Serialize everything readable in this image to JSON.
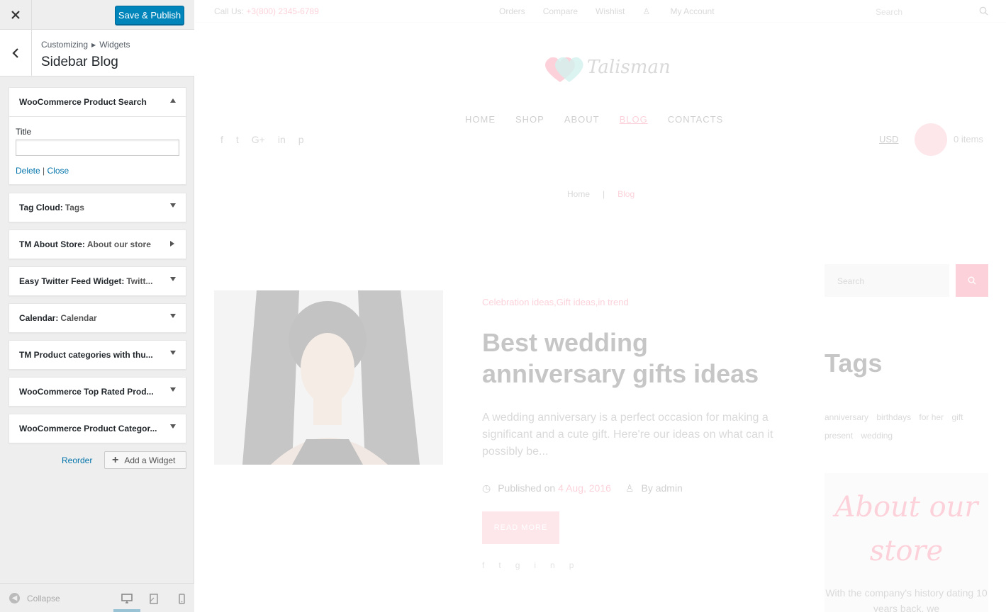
{
  "customizer": {
    "save_label": "Save & Publish",
    "breadcrumb": [
      "Customizing",
      "Widgets"
    ],
    "section_title": "Sidebar Blog",
    "widgets": [
      {
        "name": "WooCommerce Product Search",
        "subtitle": "",
        "state": "expanded"
      },
      {
        "name": "Tag Cloud:",
        "subtitle": "Tags",
        "state": "collapsed"
      },
      {
        "name": "TM About Store:",
        "subtitle": "About our store",
        "state": "collapsed-right"
      },
      {
        "name": "Easy Twitter Feed Widget:",
        "subtitle": "Twitt...",
        "state": "collapsed"
      },
      {
        "name": "Calendar:",
        "subtitle": "Calendar",
        "state": "collapsed"
      },
      {
        "name": "TM Product categories with thu...",
        "subtitle": "",
        "state": "collapsed"
      },
      {
        "name": "WooCommerce Top Rated Prod...",
        "subtitle": "",
        "state": "collapsed"
      },
      {
        "name": "WooCommerce Product Categor...",
        "subtitle": "",
        "state": "collapsed"
      }
    ],
    "expanded_widget": {
      "title_label": "Title",
      "title_value": "",
      "delete_label": "Delete",
      "separator": "|",
      "close_label": "Close"
    },
    "reorder_label": "Reorder",
    "add_widget_label": "Add a Widget",
    "collapse_label": "Collapse",
    "devices": [
      "desktop",
      "tablet",
      "mobile"
    ],
    "active_device": "desktop"
  },
  "preview": {
    "call_label": "Call Us:",
    "phone": "+3(800) 2345-6789",
    "top_links": [
      "Orders",
      "Compare",
      "Wishlist",
      "My Account"
    ],
    "search_placeholder": "Search",
    "logo_text": "Talisman",
    "nav": [
      "HOME",
      "SHOP",
      "ABOUT",
      "BLOG",
      "CONTACTS"
    ],
    "active_nav": "BLOG",
    "currency": "USD",
    "cart_text": "0 items",
    "breadcrumb": [
      "Home",
      "|",
      "Blog"
    ],
    "post": {
      "categories": "Celebration ideas,Gift ideas,in trend",
      "title": "Best wedding anniversary gifts ideas",
      "excerpt": "A wedding anniversary is a perfect occasion for making a significant and a cute gift. Here're our ideas on what can it possibly be...",
      "published_label": "Published on",
      "date": "4 Aug, 2016",
      "author": "By admin",
      "read_more": "READ MORE"
    },
    "sidebar": {
      "search_placeholder": "Search",
      "tags_heading": "Tags",
      "tags": [
        "anniversary",
        "birthdays",
        "for her",
        "gift",
        "present",
        "wedding"
      ],
      "about_heading": "About our store",
      "about_text": "With the company's history dating 10 years back, we"
    }
  },
  "colors": {
    "wp_primary": "#0085ba",
    "link": "#0073aa",
    "accent_pink": "#f55c7a"
  }
}
